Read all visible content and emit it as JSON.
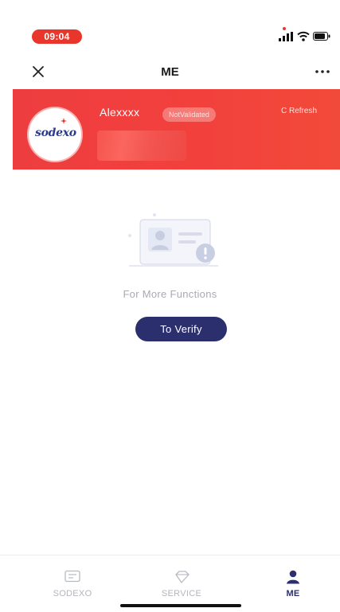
{
  "status_bar": {
    "time": "09:04",
    "icons": [
      "cellular-signal-icon",
      "wifi-icon",
      "battery-icon"
    ],
    "accent_color": "#e8362c"
  },
  "nav": {
    "title": "ME",
    "close_icon": "close-icon",
    "more_icon": "more-icon"
  },
  "profile": {
    "name": "Alexxxx",
    "status_badge": "NotValidated",
    "refresh_label": "Refresh",
    "logo_text": "sodexo",
    "header_color": "#ef3e3d",
    "details_redacted": true
  },
  "empty_state": {
    "illustration_icon": "id-card-warning-icon",
    "hint": "For More Functions",
    "verify_label": "To Verify",
    "button_color": "#2c2f6e"
  },
  "tabbar": {
    "active_index": 2,
    "items": [
      {
        "label": "SODEXO",
        "icon": "message-icon"
      },
      {
        "label": "SERVICE",
        "icon": "diamond-icon"
      },
      {
        "label": "ME",
        "icon": "person-icon"
      }
    ]
  }
}
